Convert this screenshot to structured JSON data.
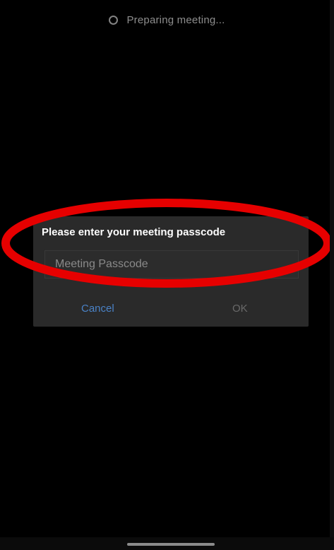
{
  "status": {
    "text": "Preparing meeting...",
    "icon": "spinner-icon"
  },
  "dialog": {
    "title": "Please enter your meeting passcode",
    "input_placeholder": "Meeting Passcode",
    "input_value": "",
    "cancel_label": "Cancel",
    "ok_label": "OK"
  },
  "colors": {
    "background": "#000000",
    "dialog_background": "#2a2a2a",
    "cancel_text": "#4a82c6",
    "ok_text_disabled": "#6a6a6a",
    "annotation": "#e60000"
  }
}
